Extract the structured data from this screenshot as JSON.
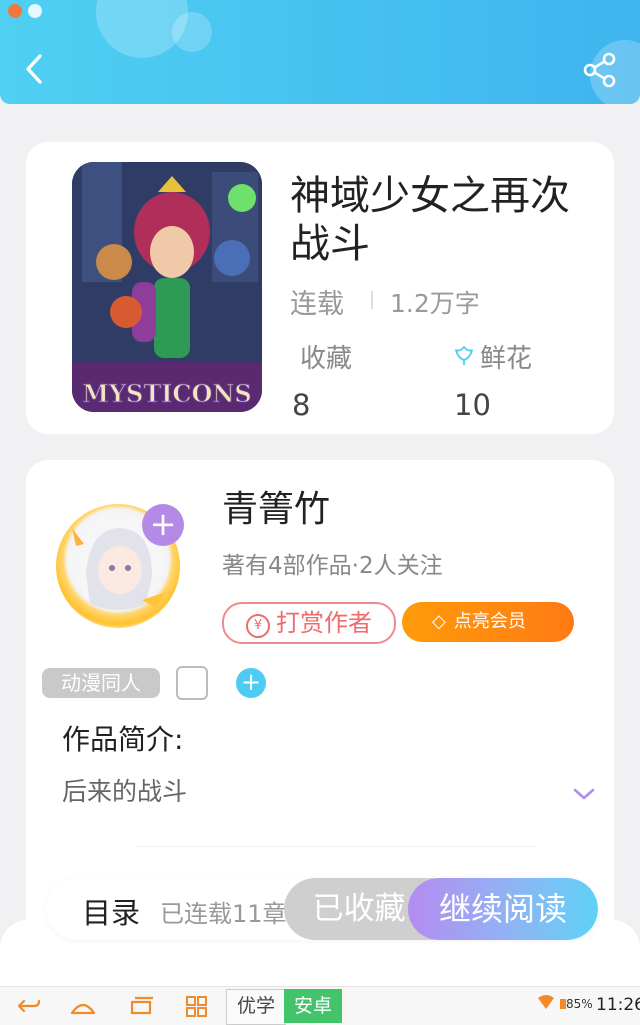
{
  "header": {
    "back_icon": "chevron-left-icon",
    "share_icon": "share-icon",
    "colors": {
      "start": "#4fd0f2",
      "end": "#3fb4ef"
    }
  },
  "book": {
    "title": "神域少女之再次战斗",
    "status": "连载",
    "word_count": "1.2万字",
    "cover_lettering": "MYSTICONS",
    "stats": [
      {
        "label": "收藏",
        "value": "8",
        "icon": ""
      },
      {
        "label": "鲜花",
        "value": "10",
        "icon": "flower-icon"
      }
    ]
  },
  "author": {
    "name": "青箐竹",
    "meta": "著有4部作品·2人关注",
    "reward_label": "打赏作者",
    "reward_symbol": "¥",
    "vip_label": "点亮会员",
    "follow_symbol": "+",
    "tag": "动漫同人",
    "tag_add_symbol": "+"
  },
  "intro": {
    "title": "作品简介:",
    "text": "后来的战斗"
  },
  "bottom": {
    "toc_label": "目录",
    "serial_label": "已连载11章",
    "fav_label": "已收藏",
    "read_label": "继续阅读",
    "accent": "#b48cf0"
  },
  "navbar": {
    "youxue": "优学",
    "anzhuo": "安卓",
    "battery": "85%",
    "time": "11:26"
  }
}
